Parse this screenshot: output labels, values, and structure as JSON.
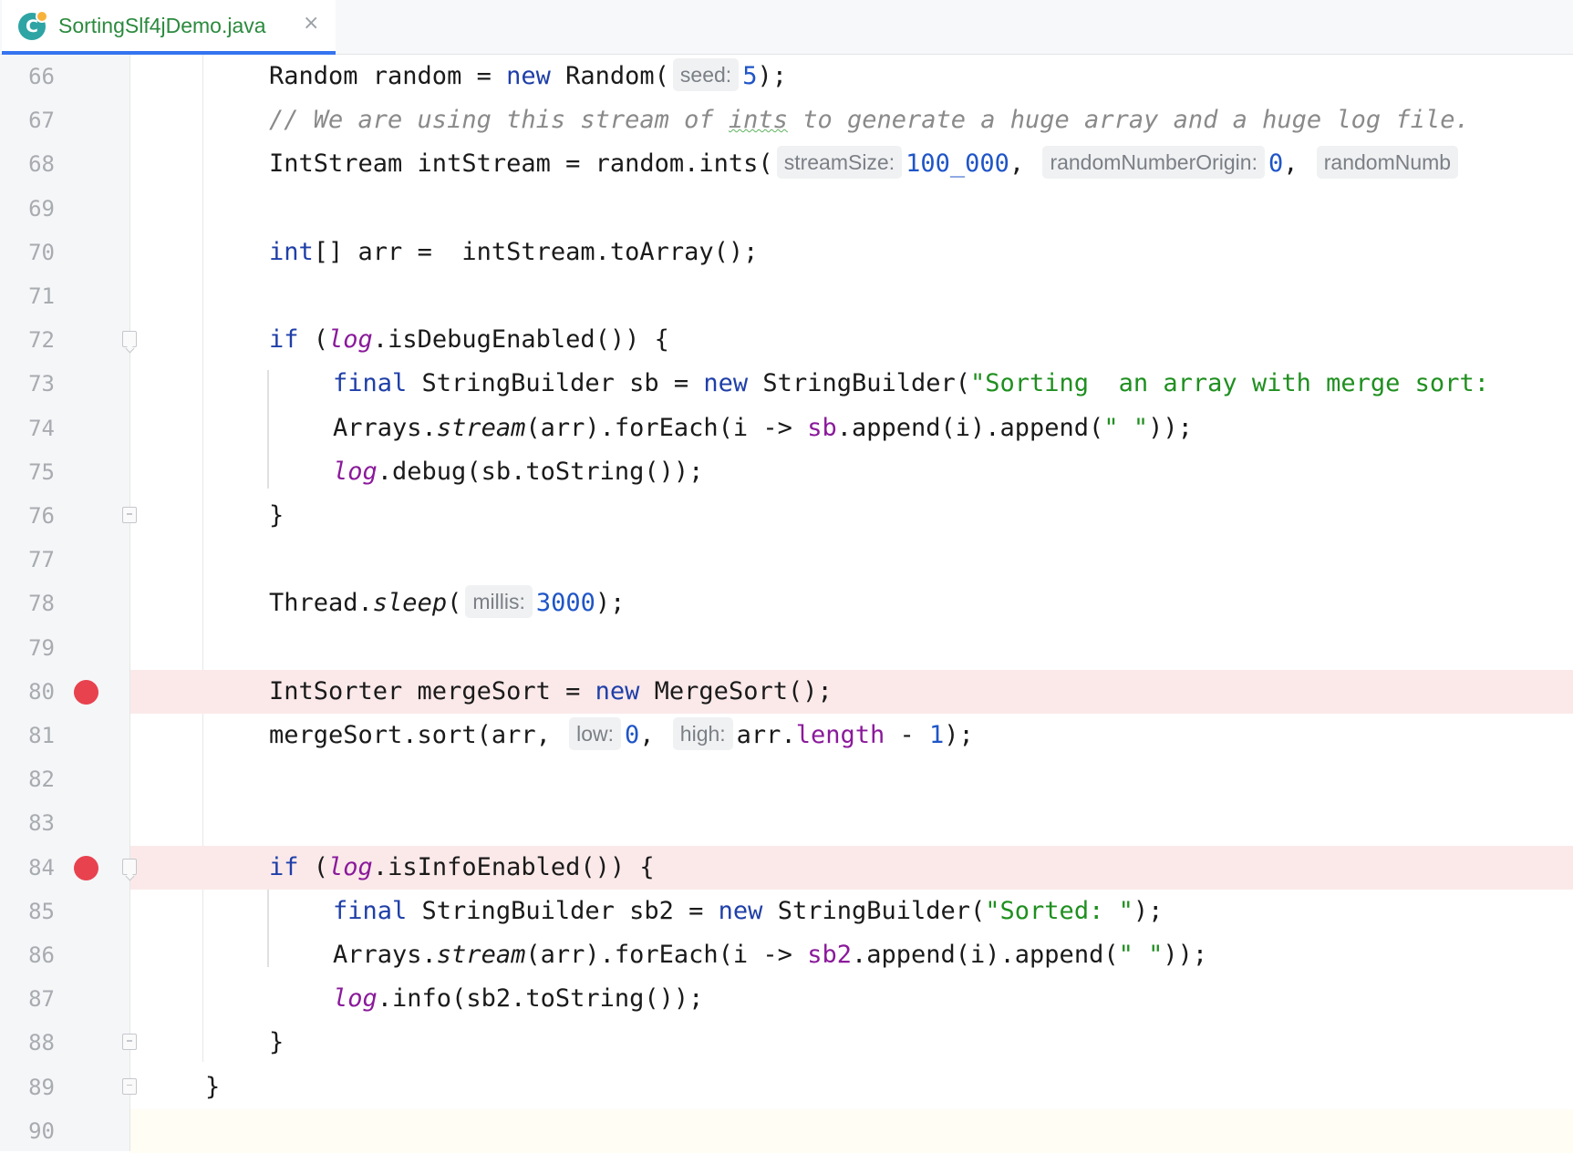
{
  "tab": {
    "title": "SortingSlf4jDemo.java",
    "icon": "C",
    "close": "×"
  },
  "lines": [
    {
      "n": "66",
      "indent": 2,
      "tokens": [
        {
          "t": "Random random = "
        },
        {
          "t": "new",
          "c": "kw"
        },
        {
          "t": " Random("
        },
        {
          "t": "seed:",
          "c": "hint"
        },
        {
          "t": "5",
          "c": "num"
        },
        {
          "t": ");"
        }
      ]
    },
    {
      "n": "67",
      "indent": 2,
      "tokens": [
        {
          "t": "// We are using this stream of ",
          "c": "cmt"
        },
        {
          "t": "ints",
          "c": "cmt squig"
        },
        {
          "t": " to generate a huge array and a huge log file.",
          "c": "cmt"
        }
      ]
    },
    {
      "n": "68",
      "indent": 2,
      "tokens": [
        {
          "t": "IntStream intStream = random.ints("
        },
        {
          "t": "streamSize:",
          "c": "hint"
        },
        {
          "t": "100_000",
          "c": "num"
        },
        {
          "t": ", "
        },
        {
          "t": "randomNumberOrigin:",
          "c": "hint"
        },
        {
          "t": "0",
          "c": "num"
        },
        {
          "t": ", "
        },
        {
          "t": "randomNumb",
          "c": "hint"
        }
      ]
    },
    {
      "n": "69",
      "indent": 2,
      "tokens": []
    },
    {
      "n": "70",
      "indent": 2,
      "tokens": [
        {
          "t": "int",
          "c": "kw"
        },
        {
          "t": "[] arr =  intStream.toArray();"
        }
      ]
    },
    {
      "n": "71",
      "indent": 2,
      "tokens": []
    },
    {
      "n": "72",
      "indent": 2,
      "fold": "open",
      "tokens": [
        {
          "t": "if",
          "c": "kw"
        },
        {
          "t": " ("
        },
        {
          "t": "log",
          "c": "fld itl"
        },
        {
          "t": ".isDebugEnabled()) {"
        }
      ]
    },
    {
      "n": "73",
      "indent": 3,
      "tokens": [
        {
          "t": "final",
          "c": "kw"
        },
        {
          "t": " StringBuilder sb = "
        },
        {
          "t": "new",
          "c": "kw"
        },
        {
          "t": " StringBuilder("
        },
        {
          "t": "\"Sorting  an array with merge sort:",
          "c": "str"
        }
      ]
    },
    {
      "n": "74",
      "indent": 3,
      "tokens": [
        {
          "t": "Arrays."
        },
        {
          "t": "stream",
          "c": "itl"
        },
        {
          "t": "(arr).forEach(i -> "
        },
        {
          "t": "sb",
          "c": "fld"
        },
        {
          "t": ".append(i).append("
        },
        {
          "t": "\" \"",
          "c": "str"
        },
        {
          "t": "));"
        }
      ]
    },
    {
      "n": "75",
      "indent": 3,
      "tokens": [
        {
          "t": "log",
          "c": "fld itl"
        },
        {
          "t": ".debug(sb.toString());"
        }
      ]
    },
    {
      "n": "76",
      "indent": 2,
      "fold": "end",
      "tokens": [
        {
          "t": "}"
        }
      ]
    },
    {
      "n": "77",
      "indent": 2,
      "tokens": []
    },
    {
      "n": "78",
      "indent": 2,
      "tokens": [
        {
          "t": "Thread."
        },
        {
          "t": "sleep",
          "c": "itl"
        },
        {
          "t": "("
        },
        {
          "t": "millis:",
          "c": "hint"
        },
        {
          "t": "3000",
          "c": "num"
        },
        {
          "t": ");"
        }
      ]
    },
    {
      "n": "79",
      "indent": 2,
      "tokens": []
    },
    {
      "n": "80",
      "indent": 2,
      "bp": true,
      "tokens": [
        {
          "t": "IntSorter mergeSort = "
        },
        {
          "t": "new",
          "c": "kw"
        },
        {
          "t": " MergeSort();"
        }
      ]
    },
    {
      "n": "81",
      "indent": 2,
      "tokens": [
        {
          "t": "mergeSort.sort(arr, "
        },
        {
          "t": "low:",
          "c": "hint"
        },
        {
          "t": "0",
          "c": "num"
        },
        {
          "t": ", "
        },
        {
          "t": "high:",
          "c": "hint"
        },
        {
          "t": "arr."
        },
        {
          "t": "length",
          "c": "fld"
        },
        {
          "t": " - "
        },
        {
          "t": "1",
          "c": "num"
        },
        {
          "t": ");"
        }
      ]
    },
    {
      "n": "82",
      "indent": 2,
      "tokens": []
    },
    {
      "n": "83",
      "indent": 2,
      "tokens": []
    },
    {
      "n": "84",
      "indent": 2,
      "bp": true,
      "fold": "open",
      "tokens": [
        {
          "t": "if",
          "c": "kw"
        },
        {
          "t": " ("
        },
        {
          "t": "log",
          "c": "fld itl"
        },
        {
          "t": ".isInfoEnabled()) {"
        }
      ]
    },
    {
      "n": "85",
      "indent": 3,
      "tokens": [
        {
          "t": "final",
          "c": "kw"
        },
        {
          "t": " StringBuilder sb2 = "
        },
        {
          "t": "new",
          "c": "kw"
        },
        {
          "t": " StringBuilder("
        },
        {
          "t": "\"Sorted: \"",
          "c": "str"
        },
        {
          "t": ");"
        }
      ]
    },
    {
      "n": "86",
      "indent": 3,
      "tokens": [
        {
          "t": "Arrays."
        },
        {
          "t": "stream",
          "c": "itl"
        },
        {
          "t": "(arr).forEach(i -> "
        },
        {
          "t": "sb2",
          "c": "fld"
        },
        {
          "t": ".append(i).append("
        },
        {
          "t": "\" \"",
          "c": "str"
        },
        {
          "t": "));"
        }
      ]
    },
    {
      "n": "87",
      "indent": 3,
      "tokens": [
        {
          "t": "log",
          "c": "fld itl"
        },
        {
          "t": ".info(sb2.toString());"
        }
      ]
    },
    {
      "n": "88",
      "indent": 2,
      "fold": "end",
      "tokens": [
        {
          "t": "}"
        }
      ]
    },
    {
      "n": "89",
      "indent": 1,
      "fold": "end",
      "tokens": [
        {
          "t": "}"
        }
      ]
    },
    {
      "n": "90",
      "indent": 1,
      "current": true,
      "tokens": []
    }
  ]
}
